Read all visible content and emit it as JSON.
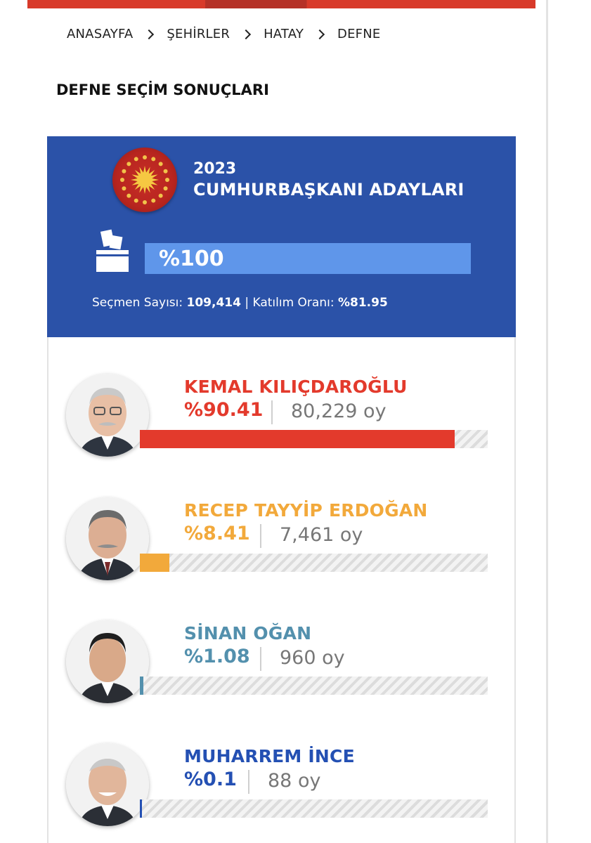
{
  "breadcrumb": [
    "ANASAYFA",
    "ŞEHİRLER",
    "HATAY",
    "DEFNE"
  ],
  "page_title": "DEFNE SEÇİM SONUÇLARI",
  "header": {
    "year": "2023",
    "title": "CUMHURBAŞKANI ADAYLARI",
    "progress_label": "%100",
    "progress_value": 1.0,
    "voters_label": "Seçmen Sayısı:",
    "voters_value": "109,414",
    "separator": "|",
    "turnout_label": "Katılım Oranı:",
    "turnout_value": "%81.95"
  },
  "candidates": [
    {
      "name": "KEMAL KILIÇDAROĞLU",
      "percent_label": "%90.41",
      "share": 0.9041,
      "votes": "80,229 oy",
      "color": "#e33a2c",
      "photo_icon": "candidate-photo"
    },
    {
      "name": "RECEP TAYYİP ERDOĞAN",
      "percent_label": "%8.41",
      "share": 0.0841,
      "votes": "7,461 oy",
      "color": "#f2a93b",
      "photo_icon": "candidate-photo"
    },
    {
      "name": "SİNAN OĞAN",
      "percent_label": "%1.08",
      "share": 0.0108,
      "votes": "960 oy",
      "color": "#5390ad",
      "photo_icon": "candidate-photo"
    },
    {
      "name": "MUHARREM İNCE",
      "percent_label": "%0.1",
      "share": 0.001,
      "votes": "88 oy",
      "color": "#2450b3",
      "photo_icon": "candidate-photo"
    }
  ],
  "colors": {
    "header_bg": "#2b52a8",
    "progress_bg": "#6c9de8",
    "accent_red": "#d83a2a"
  },
  "icons": {
    "seal": "presidential-seal-icon",
    "ballot": "ballot-box-icon",
    "breadcrumb_separator": "chevron-right-icon"
  }
}
